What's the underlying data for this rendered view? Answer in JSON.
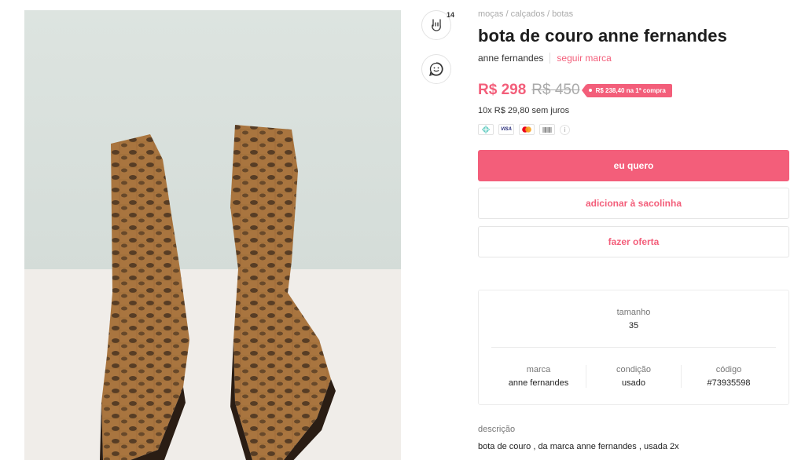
{
  "product": {
    "photo_alt": "bota de couro anne fernandes",
    "like_count": "14"
  },
  "icons": {
    "like": "rock-hand-icon",
    "chat": "smiley-chat-icon",
    "payment": [
      "pix-icon",
      "visa-icon",
      "mastercard-icon",
      "boleto-icon",
      "info-icon"
    ]
  },
  "breadcrumb": {
    "items": [
      "moças",
      "calçados",
      "botas"
    ],
    "separator": " / "
  },
  "title": "bota de couro anne fernandes",
  "brand": {
    "name": "anne fernandes",
    "follow_label": "seguir marca"
  },
  "pricing": {
    "price": "R$ 298",
    "old_price": "R$ 450",
    "promo": "R$ 238,40 na 1ª compra",
    "installments": "10x R$ 29,80 sem juros"
  },
  "payment_labels": {
    "visa": "VISA"
  },
  "actions": {
    "buy_label": "eu quero",
    "bag_label": "adicionar à sacolinha",
    "offer_label": "fazer oferta"
  },
  "specs": {
    "size_label": "tamanho",
    "size_value": "35",
    "brand_label": "marca",
    "brand_value": "anne fernandes",
    "condition_label": "condição",
    "condition_value": "usado",
    "code_label": "código",
    "code_value": "#73935598"
  },
  "description": {
    "label": "descrição",
    "text": "bota de couro , da marca anne fernandes , usada 2x"
  },
  "colors": {
    "accent": "#f35e7a",
    "boot_leather": "#a9753f",
    "wall": "#dde4e0"
  }
}
